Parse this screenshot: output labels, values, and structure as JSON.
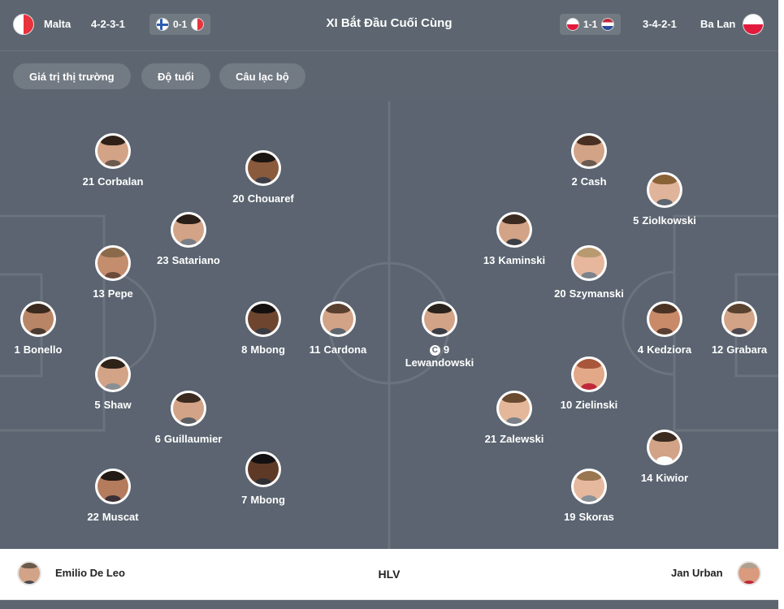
{
  "header": {
    "home_team": "Malta",
    "home_formation": "4-2-3-1",
    "home_last_score": "0-1",
    "title": "XI Bắt Đầu Cuối Cùng",
    "away_last_score": "1-1",
    "away_formation": "3-4-2-1",
    "away_team": "Ba Lan"
  },
  "filters": [
    "Giá trị thị trường",
    "Độ tuổi",
    "Câu lạc bộ"
  ],
  "home_players": [
    {
      "number": "21",
      "name": "Corbalan"
    },
    {
      "number": "20",
      "name": "Chouaref"
    },
    {
      "number": "23",
      "name": "Satariano"
    },
    {
      "number": "13",
      "name": "Pepe"
    },
    {
      "number": "1",
      "name": "Bonello"
    },
    {
      "number": "8",
      "name": "Mbong"
    },
    {
      "number": "11",
      "name": "Cardona"
    },
    {
      "number": "5",
      "name": "Shaw"
    },
    {
      "number": "6",
      "name": "Guillaumier"
    },
    {
      "number": "7",
      "name": "Mbong"
    },
    {
      "number": "22",
      "name": "Muscat"
    }
  ],
  "away_players": [
    {
      "number": "2",
      "name": "Cash"
    },
    {
      "number": "5",
      "name": "Ziolkowski"
    },
    {
      "number": "13",
      "name": "Kaminski"
    },
    {
      "number": "20",
      "name": "Szymanski"
    },
    {
      "number": "9",
      "name": "Lewandowski",
      "captain_mark": "C"
    },
    {
      "number": "4",
      "name": "Kedziora"
    },
    {
      "number": "12",
      "name": "Grabara"
    },
    {
      "number": "10",
      "name": "Zielinski"
    },
    {
      "number": "21",
      "name": "Zalewski"
    },
    {
      "number": "14",
      "name": "Kiwior"
    },
    {
      "number": "19",
      "name": "Skoras"
    }
  ],
  "coach": {
    "home_name": "Emilio De Leo",
    "label": "HLV",
    "away_name": "Jan Urban"
  },
  "colors": {
    "background": "#5d6670",
    "pitch": "#5b6470",
    "button": "#727a83",
    "malta_red": "#e8323c",
    "poland_red": "#e21b3c"
  },
  "icons": [
    "malta-flag-icon",
    "poland-flag-icon",
    "finland-flag-icon",
    "netherlands-flag-icon",
    "captain-icon",
    "player-photo-icon",
    "coach-photo-icon"
  ]
}
